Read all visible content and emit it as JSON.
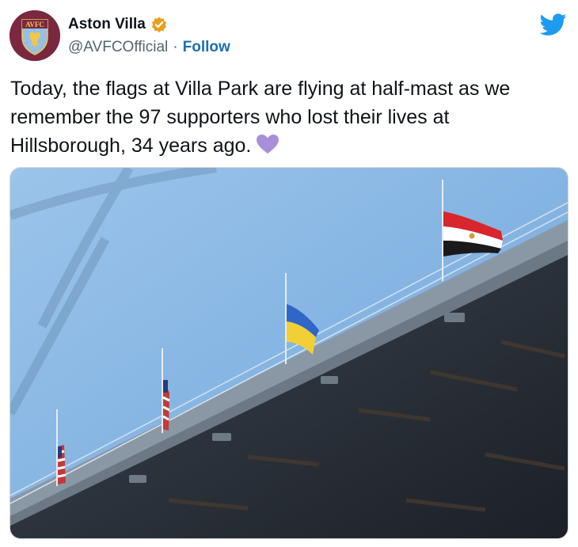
{
  "tweet": {
    "display_name": "Aston Villa",
    "handle": "@AVFCOfficial",
    "separator": "·",
    "follow_label": "Follow",
    "avatar_text": "AVFC",
    "text": "Today, the flags at Villa Park are flying at half-mast as we remember the 97 supporters who lost their lives at Hillsborough, 34 years ago.",
    "emoji": "purple-heart"
  },
  "icons": {
    "verified": "verified-badge-icon",
    "brand": "twitter-bird-icon"
  },
  "colors": {
    "verified_badge": "#e8a020",
    "twitter_blue": "#1d9bf0",
    "follow_link": "#1d6fb0",
    "handle_gray": "#536471",
    "heart_purple": "#a98fd8",
    "club_claret": "#7a2740",
    "club_blue": "#95bfe5",
    "sky": "#8ab8e6"
  }
}
